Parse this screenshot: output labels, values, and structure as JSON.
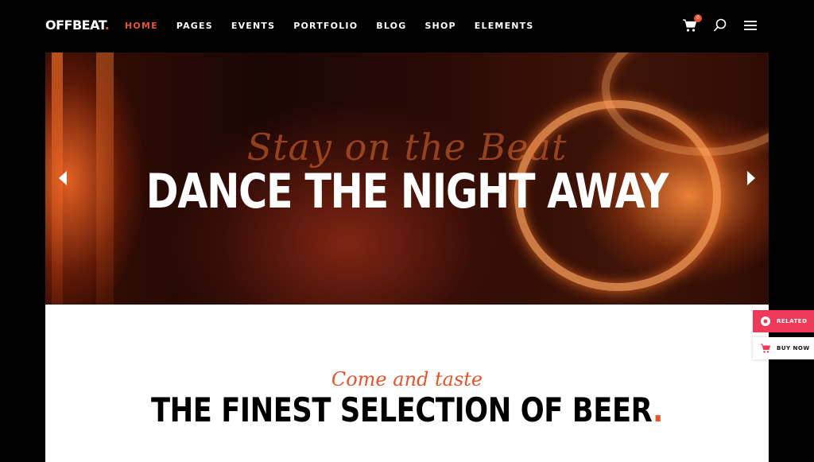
{
  "header": {
    "logo_text": "OFFBEAT",
    "logo_dot": ".",
    "nav": [
      {
        "label": "HOME",
        "active": true
      },
      {
        "label": "PAGES"
      },
      {
        "label": "EVENTS"
      },
      {
        "label": "PORTFOLIO"
      },
      {
        "label": "BLOG"
      },
      {
        "label": "SHOP"
      },
      {
        "label": "ELEMENTS"
      }
    ],
    "cart_count": "0",
    "icons": [
      "cart-icon",
      "search-icon",
      "menu-icon"
    ]
  },
  "hero": {
    "script": "Stay on the Beat",
    "title": "DANCE THE NIGHT AWAY",
    "prev_icon": "arrow-left-icon",
    "next_icon": "arrow-right-icon"
  },
  "section": {
    "script": "Come and taste",
    "title": "THE FINEST SELECTION OF BEER",
    "title_dot": "."
  },
  "side": {
    "related": "RELATED",
    "buy": "BUY NOW"
  },
  "colors": {
    "accent": "#e8542a",
    "related_bg": "#ef3a5a"
  }
}
